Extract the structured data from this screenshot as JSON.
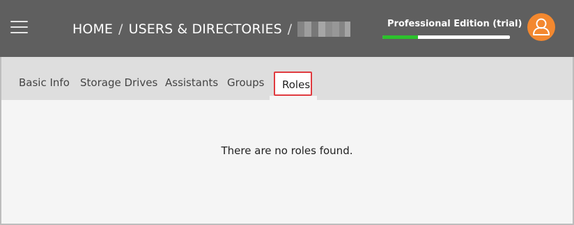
{
  "header": {
    "menu_icon": "hamburger-menu-icon",
    "breadcrumb": {
      "items": [
        "HOME",
        "USERS & DIRECTORIES"
      ],
      "separator": "/"
    },
    "edition": {
      "icon": "shopping-cart-icon",
      "label": "Professional Edition (trial)",
      "trial_progress_percent": 28,
      "progress_color": "#2cc12c"
    },
    "avatar_icon": "user-avatar-icon",
    "avatar_color": "#f3882f"
  },
  "tabs": {
    "items": [
      "Basic Info",
      "Storage Drives",
      "Assistants",
      "Groups",
      "Roles"
    ],
    "active": "Roles",
    "active_highlight_color": "#e03a3f"
  },
  "content": {
    "empty_message": "There are no roles found."
  }
}
